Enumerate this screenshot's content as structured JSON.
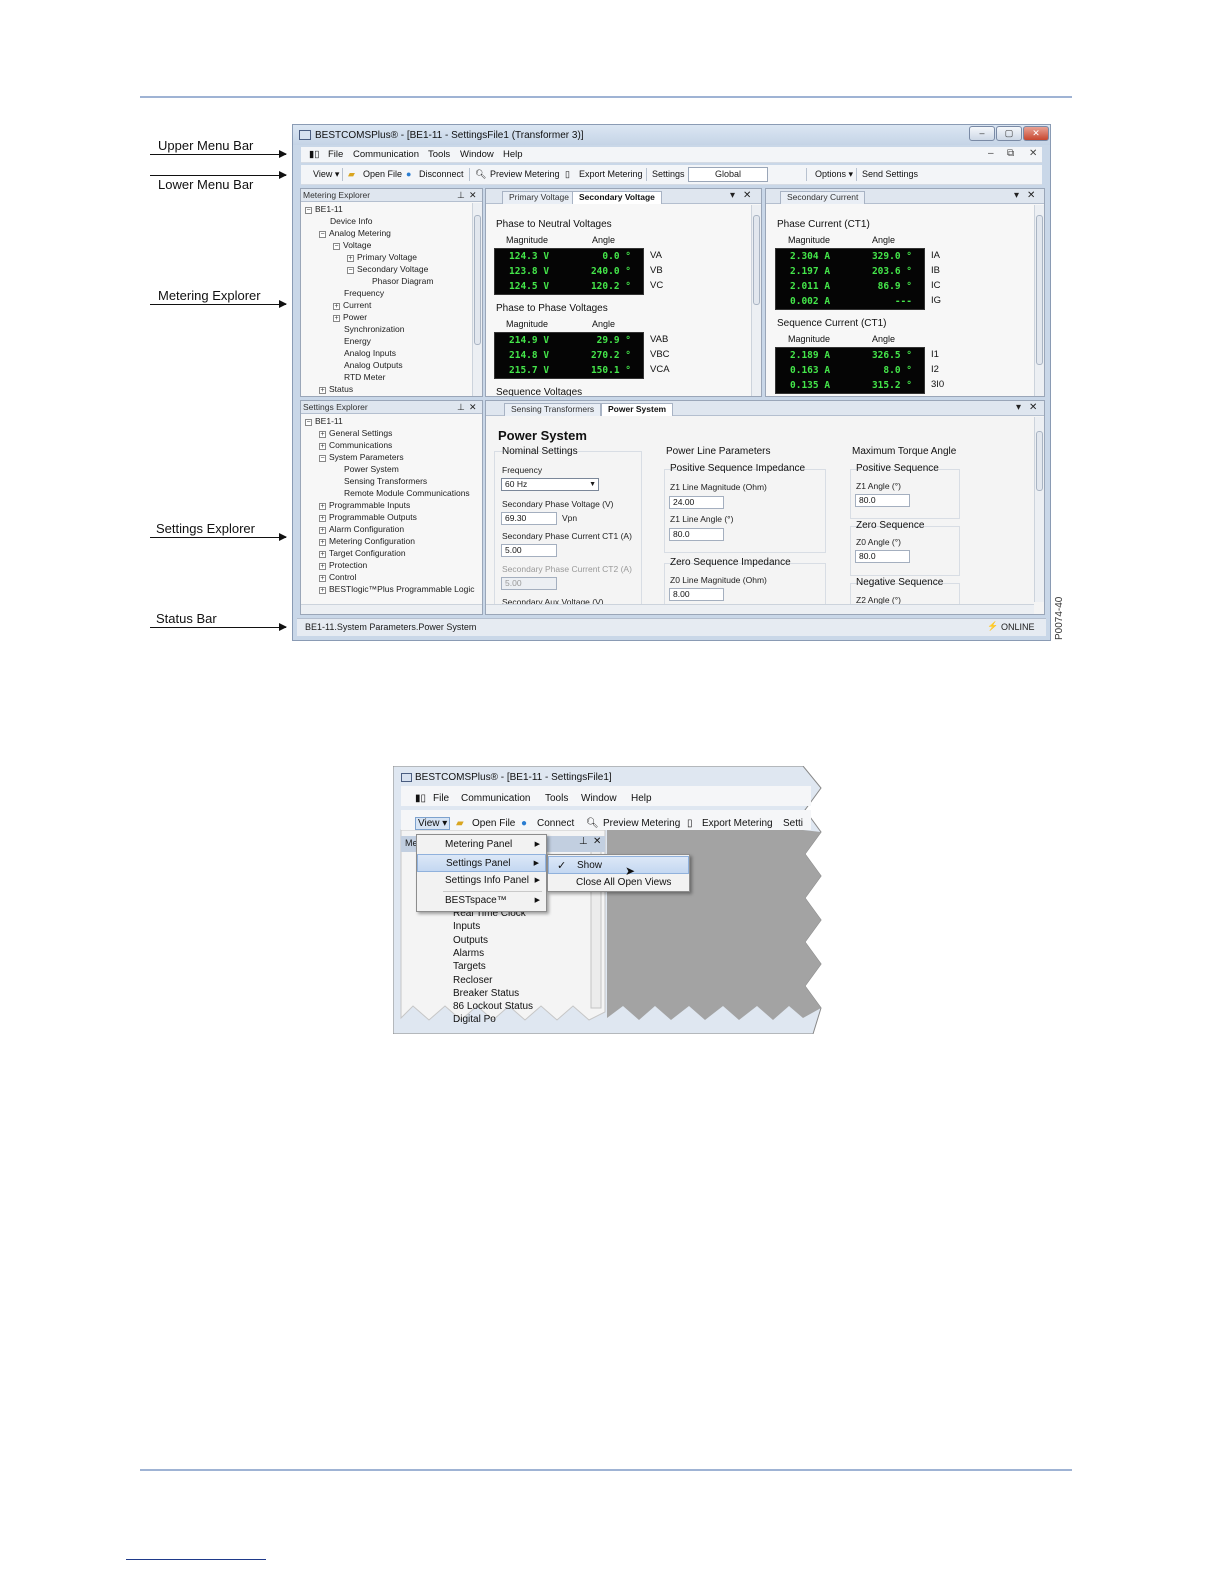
{
  "figure1": {
    "figure_id": "P0074-40",
    "callouts": [
      "Upper Menu Bar",
      "Lower Menu Bar",
      "Metering Explorer",
      "Settings Explorer",
      "Status Bar"
    ],
    "window": {
      "title": "BESTCOMSPlus® - [BE1-11 - SettingsFile1 (Transformer 3)]",
      "menu": [
        "File",
        "Communication",
        "Tools",
        "Window",
        "Help"
      ],
      "toolbar": {
        "view": "View ▾",
        "open_file": "Open File",
        "disconnect": "Disconnect",
        "preview_metering": "Preview Metering",
        "export_metering": "Export Metering",
        "settings": "Settings",
        "settings_value": "Global",
        "options": "Options ▾",
        "send_settings": "Send Settings"
      },
      "metering_explorer": {
        "title": "Metering Explorer",
        "tree": [
          {
            "label": "BE1-11",
            "exp": "−"
          },
          {
            "label": "Device Info",
            "exp": ""
          },
          {
            "label": "Analog Metering",
            "exp": "−"
          },
          {
            "label": "Voltage",
            "exp": "−"
          },
          {
            "label": "Primary Voltage",
            "exp": "+"
          },
          {
            "label": "Secondary Voltage",
            "exp": "−"
          },
          {
            "label": "Phasor Diagram",
            "exp": ""
          },
          {
            "label": "Frequency",
            "exp": ""
          },
          {
            "label": "Current",
            "exp": "+"
          },
          {
            "label": "Power",
            "exp": "+"
          },
          {
            "label": "Synchronization",
            "exp": ""
          },
          {
            "label": "Energy",
            "exp": ""
          },
          {
            "label": "Analog Inputs",
            "exp": ""
          },
          {
            "label": "Analog Outputs",
            "exp": ""
          },
          {
            "label": "RTD Meter",
            "exp": ""
          },
          {
            "label": "Status",
            "exp": "+"
          }
        ]
      },
      "settings_explorer": {
        "title": "Settings Explorer",
        "tree": [
          {
            "label": "BE1-11",
            "exp": "−"
          },
          {
            "label": "General Settings",
            "exp": "+"
          },
          {
            "label": "Communications",
            "exp": "+"
          },
          {
            "label": "System Parameters",
            "exp": "−"
          },
          {
            "label": "Power System",
            "exp": ""
          },
          {
            "label": "Sensing Transformers",
            "exp": ""
          },
          {
            "label": "Remote Module Communications",
            "exp": ""
          },
          {
            "label": "Programmable Inputs",
            "exp": "+"
          },
          {
            "label": "Programmable Outputs",
            "exp": "+"
          },
          {
            "label": "Alarm Configuration",
            "exp": "+"
          },
          {
            "label": "Metering Configuration",
            "exp": "+"
          },
          {
            "label": "Target Configuration",
            "exp": "+"
          },
          {
            "label": "Protection",
            "exp": "+"
          },
          {
            "label": "Control",
            "exp": "+"
          },
          {
            "label": "BESTlogic™Plus Programmable Logic",
            "exp": "+"
          }
        ]
      },
      "voltage_pane": {
        "tabs": [
          "Primary Voltage",
          "Secondary Voltage"
        ],
        "phase_neutral": {
          "title": "Phase to Neutral Voltages",
          "magnitude_header": "Magnitude",
          "angle_header": "Angle",
          "rows": [
            {
              "mag": "124.3 V",
              "ang": "0.0 °",
              "label": "VA"
            },
            {
              "mag": "123.8 V",
              "ang": "240.0 °",
              "label": "VB"
            },
            {
              "mag": "124.5 V",
              "ang": "120.2 °",
              "label": "VC"
            }
          ]
        },
        "phase_phase": {
          "title": "Phase to Phase Voltages",
          "magnitude_header": "Magnitude",
          "angle_header": "Angle",
          "rows": [
            {
              "mag": "214.9 V",
              "ang": "29.9 °",
              "label": "VAB"
            },
            {
              "mag": "214.8 V",
              "ang": "270.2 °",
              "label": "VBC"
            },
            {
              "mag": "215.7 V",
              "ang": "150.1 °",
              "label": "VCA"
            }
          ]
        },
        "sequence_title": "Sequence Voltages"
      },
      "current_pane": {
        "tabs": [
          "Secondary Current"
        ],
        "phase_current": {
          "title": "Phase Current (CT1)",
          "magnitude_header": "Magnitude",
          "angle_header": "Angle",
          "rows": [
            {
              "mag": "2.304 A",
              "ang": "329.0 °",
              "label": "IA"
            },
            {
              "mag": "2.197 A",
              "ang": "203.6 °",
              "label": "IB"
            },
            {
              "mag": "2.011 A",
              "ang": "86.9 °",
              "label": "IC"
            },
            {
              "mag": "0.002 A",
              "ang": "---",
              "label": "IG"
            }
          ]
        },
        "sequence_current": {
          "title": "Sequence Current (CT1)",
          "magnitude_header": "Magnitude",
          "angle_header": "Angle",
          "rows": [
            {
              "mag": "2.189 A",
              "ang": "326.5 °",
              "label": "I1"
            },
            {
              "mag": "0.163 A",
              "ang": "8.0 °",
              "label": "I2"
            },
            {
              "mag": "0.135 A",
              "ang": "315.2 °",
              "label": "3I0"
            }
          ]
        }
      },
      "settings_pane": {
        "tabs": [
          "Sensing Transformers",
          "Power System"
        ],
        "heading": "Power System",
        "nominal": {
          "title": "Nominal Settings",
          "frequency_label": "Frequency",
          "frequency_value": "60 Hz",
          "sec_phase_voltage_label": "Secondary Phase Voltage (V)",
          "sec_phase_voltage_value": "69.30",
          "sec_phase_voltage_unit": "Vpn",
          "sec_phase_current_ct1_label": "Secondary Phase Current CT1 (A)",
          "sec_phase_current_ct1_value": "5.00",
          "sec_phase_current_ct2_label": "Secondary Phase Current CT2 (A)",
          "sec_phase_current_ct2_value": "5.00",
          "sec_aux_voltage_label": "Secondary Aux Voltage (V)"
        },
        "power_line": {
          "title": "Power Line Parameters",
          "pos_seq_title": "Positive Sequence Impedance",
          "z1_mag_label": "Z1 Line Magnitude (Ohm)",
          "z1_mag_value": "24.00",
          "z1_angle_label": "Z1 Line Angle (°)",
          "z1_angle_value": "80.0",
          "zero_seq_title": "Zero Sequence Impedance",
          "z0_mag_label": "Z0 Line Magnitude (Ohm)",
          "z0_mag_value": "8.00"
        },
        "max_torque": {
          "title": "Maximum Torque Angle",
          "pos_title": "Positive Sequence",
          "z1_angle_label": "Z1 Angle (°)",
          "z1_angle_value": "80.0",
          "zero_title": "Zero Sequence",
          "z0_angle_label": "Z0 Angle (°)",
          "z0_angle_value": "80.0",
          "neg_title": "Negative Sequence",
          "z2_angle_label": "Z2 Angle (°)"
        }
      },
      "status_bar": {
        "path": "BE1-11.System Parameters.Power System",
        "connection": "ONLINE"
      }
    }
  },
  "figure2": {
    "title": "BESTCOMSPlus® - [BE1-11 - SettingsFile1]",
    "menu": [
      "File",
      "Communication",
      "Tools",
      "Window",
      "Help"
    ],
    "toolbar": {
      "view": "View ▾",
      "open_file": "Open File",
      "connect": "Connect",
      "preview_metering": "Preview Metering",
      "export_metering": "Export Metering",
      "settings_partial": "Setti"
    },
    "view_menu": [
      "Metering Panel",
      "Settings Panel",
      "Settings Info Panel",
      "BESTspace™"
    ],
    "submenu": {
      "show": "Show",
      "close_all": "Close All Open Views"
    },
    "pane_head_partial": "Me",
    "tree": [
      "Real Time Clock",
      "Inputs",
      "Outputs",
      "Alarms",
      "Targets",
      "Recloser",
      "Breaker Status",
      "86 Lockout Status",
      "Digital Po"
    ]
  }
}
